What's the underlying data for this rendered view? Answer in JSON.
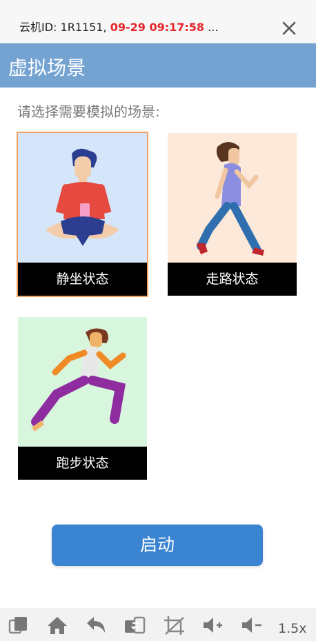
{
  "header": {
    "info_prefix": "云机ID: 1R1151,",
    "info_time": "09-29 09:17:58",
    "info_suffix": "...",
    "close_icon": "close-icon"
  },
  "page": {
    "title": "虚拟场景",
    "prompt": "请选择需要模拟的场景:"
  },
  "scenes": [
    {
      "label": "静坐状态",
      "selected": true,
      "bg": "#d6e6fa",
      "icon": "sitting-person-icon"
    },
    {
      "label": "走路状态",
      "selected": false,
      "bg": "#fde9d9",
      "icon": "walking-person-icon"
    },
    {
      "label": "跑步状态",
      "selected": false,
      "bg": "#d8f6dd",
      "icon": "running-person-icon"
    }
  ],
  "start_label": "启动",
  "toolbar": {
    "icons": [
      "copy-icon",
      "home-icon",
      "back-icon",
      "switch-icon",
      "crop-icon",
      "volume-up-icon",
      "volume-down-icon"
    ],
    "zoom": "1.5x"
  },
  "colors": {
    "accent": "#3a84d2",
    "title_bar": "#74a3d2",
    "selected_border": "#f0a060",
    "time_red": "#e3262b"
  }
}
